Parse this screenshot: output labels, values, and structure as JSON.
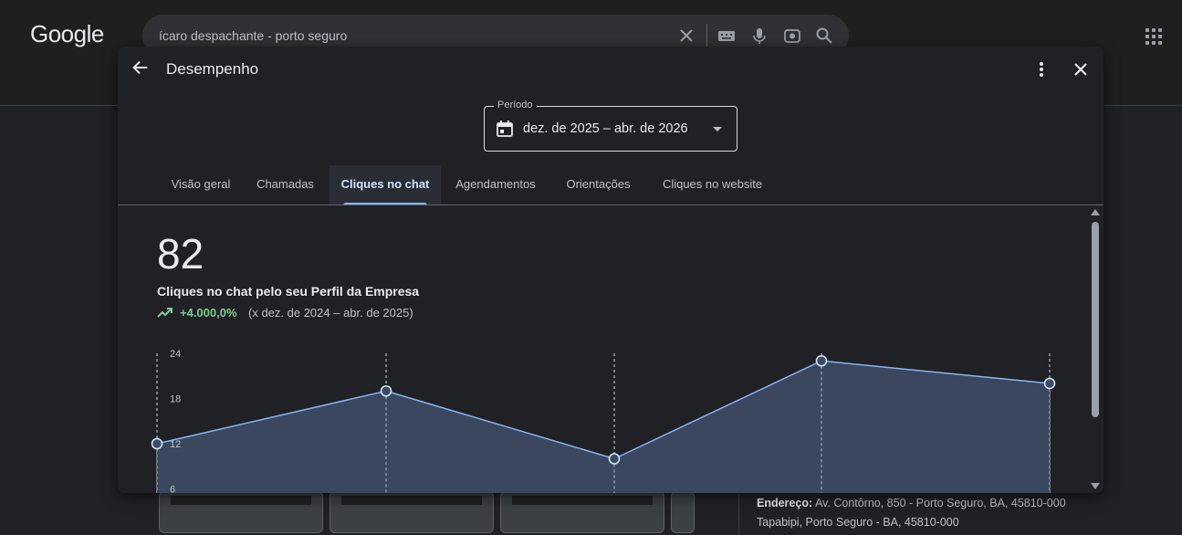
{
  "google": {
    "logo": "Google",
    "search_value": "ícaro despachante - porto seguro",
    "address_label": "Endereço:",
    "address_value": "Av. Contôrno, 850 - Porto Seguro, BA, 45810-000 Tapabipi, Porto Seguro - BA, 45810-000"
  },
  "dialog": {
    "title": "Desempenho",
    "period": {
      "label": "Período",
      "value": "dez. de 2025 – abr. de 2026"
    },
    "tabs": [
      {
        "label": "Visão geral",
        "active": false
      },
      {
        "label": "Chamadas",
        "active": false
      },
      {
        "label": "Cliques no chat",
        "active": true
      },
      {
        "label": "Agendamentos",
        "active": false
      },
      {
        "label": "Orientações",
        "active": false
      },
      {
        "label": "Cliques no website",
        "active": false
      }
    ],
    "metric": {
      "value": "82",
      "label": "Cliques no chat pelo seu Perfil da Empresa",
      "change": "+4.000,0%",
      "compare": "(x dez. de 2024 – abr. de 2025)"
    }
  },
  "colors": {
    "accent": "#8ab4f8",
    "positive": "#81c995",
    "area_fill": "#3c4a63"
  },
  "chart_data": {
    "type": "area",
    "x": [
      1,
      2,
      3,
      4,
      5
    ],
    "series": [
      {
        "values": [
          12,
          19,
          10,
          23,
          20
        ]
      }
    ],
    "y_ticks": [
      "24",
      "18",
      "12",
      "6"
    ],
    "ylim": [
      0,
      24
    ],
    "grid": "vertical dashed"
  }
}
